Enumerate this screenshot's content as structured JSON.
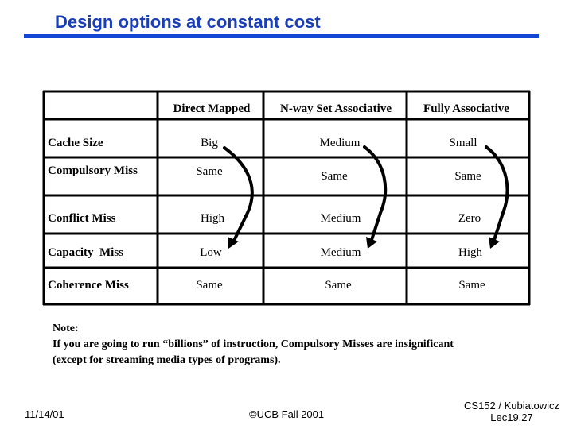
{
  "slide": {
    "title": "Design options at constant cost",
    "table": {
      "headers": [
        "",
        "Direct Mapped",
        "N-way Set Associative",
        "Fully Associative"
      ],
      "rows": [
        {
          "label": "Cache Size",
          "values": [
            "Big",
            "Medium",
            "Small"
          ]
        },
        {
          "label": "Compulsory Miss",
          "values": [
            "Same",
            "Same",
            "Same"
          ]
        },
        {
          "label": "Conflict Miss",
          "values": [
            "High",
            "Medium",
            "Zero"
          ]
        },
        {
          "label": "Capacity  Miss",
          "values": [
            "Low",
            "Medium",
            "High"
          ]
        },
        {
          "label": "Coherence Miss",
          "values": [
            "Same",
            "Same",
            "Same"
          ]
        }
      ],
      "arrows": [
        {
          "column": "Direct Mapped",
          "from": "Big",
          "to": "Low"
        },
        {
          "column": "N-way Set Associative",
          "from": "Medium",
          "to": "Medium"
        },
        {
          "column": "Fully Associative",
          "from": "Small",
          "to": "High"
        }
      ]
    },
    "note": {
      "heading": "Note:",
      "line1": "If you are going to run “billions” of instruction, Compulsory Misses are insignificant",
      "line2": "(except for streaming media types of programs)."
    },
    "footer": {
      "date": "11/14/01",
      "copyright": "©UCB Fall 2001",
      "course": "CS152 / Kubiatowicz",
      "lecture": "Lec19.27"
    },
    "colors": {
      "title": "#1a3fb5",
      "rule": "#1446d4"
    }
  }
}
